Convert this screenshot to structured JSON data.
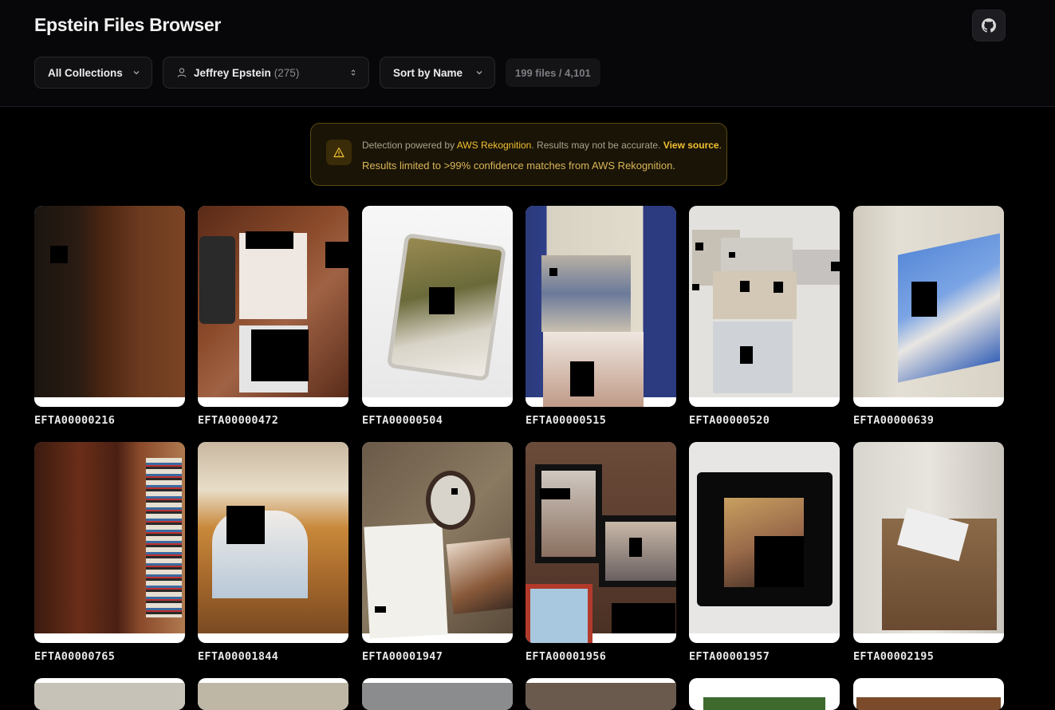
{
  "header": {
    "title": "Epstein Files Browser",
    "github_icon": "github-icon"
  },
  "filters": {
    "collections": "All Collections",
    "person": {
      "name": "Jeffrey Epstein",
      "count": "(275)"
    },
    "sort": "Sort by Name",
    "file_count": "199 files / 4,101"
  },
  "notice": {
    "prefix": "Detection powered by ",
    "provider": "AWS Rekognition",
    "middle": ". Results may not be accurate. ",
    "link": "View source",
    "end": ".",
    "line2": "Results limited to >99% confidence matches from AWS Rekognition."
  },
  "files": [
    "EFTA00000216",
    "EFTA00000472",
    "EFTA00000504",
    "EFTA00000515",
    "EFTA00000520",
    "EFTA00000639",
    "EFTA00000765",
    "EFTA00001844",
    "EFTA00001947",
    "EFTA00001956",
    "EFTA00001957",
    "EFTA00002195"
  ],
  "colors": {
    "accent": "#f1c133",
    "background": "#000000"
  }
}
